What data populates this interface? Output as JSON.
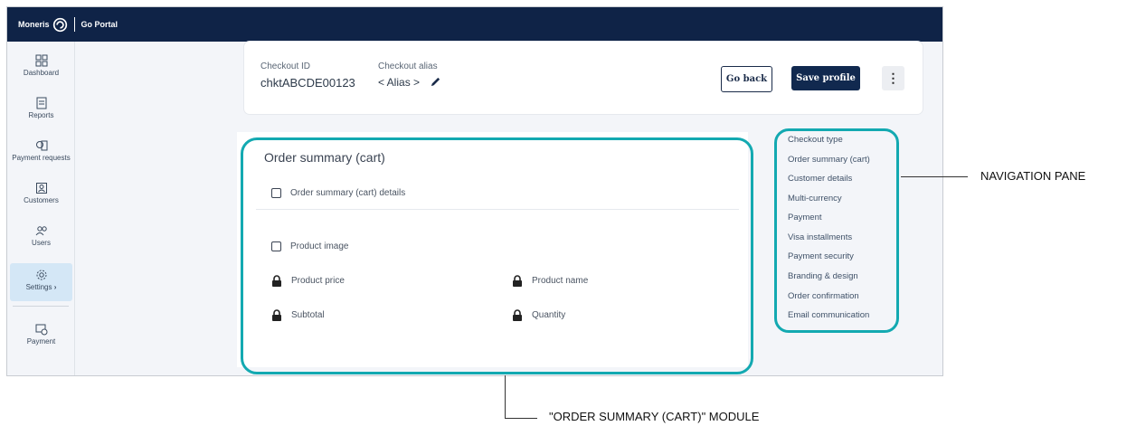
{
  "topbar": {
    "brand": "Moneris",
    "portal_bold": "Go",
    "portal_rest": " Portal"
  },
  "sidebar": {
    "items": [
      {
        "label": "Dashboard",
        "icon": "dashboard-icon"
      },
      {
        "label": "Reports",
        "icon": "reports-icon"
      },
      {
        "label": "Payment requests",
        "icon": "payment-requests-icon"
      },
      {
        "label": "Customers",
        "icon": "customers-icon"
      },
      {
        "label": "Users",
        "icon": "users-icon"
      },
      {
        "label": "Settings",
        "icon": "gear-icon",
        "active": true,
        "chevron": "›"
      },
      {
        "label": "Payment",
        "icon": "payment-icon"
      }
    ]
  },
  "header": {
    "checkout_id_label": "Checkout ID",
    "checkout_id_value": "chktABCDE00123",
    "checkout_alias_label": "Checkout alias",
    "checkout_alias_value": "< Alias >",
    "go_back_label": "Go back",
    "save_label": "Save profile",
    "more_label": "⋮"
  },
  "module": {
    "title": "Order summary (cart)",
    "details_checkbox": "Order summary (cart) details",
    "product_image": "Product image",
    "product_price": "Product price",
    "product_name": "Product name",
    "subtotal": "Subtotal",
    "quantity": "Quantity"
  },
  "right_nav": {
    "items": [
      "Checkout type",
      "Order summary (cart)",
      "Customer details",
      "Multi-currency",
      "Payment",
      "Visa installments",
      "Payment security",
      "Branding & design",
      "Order confirmation",
      "Email communication"
    ]
  },
  "callouts": {
    "navigation_pane": "NAVIGATION PANE",
    "order_summary_module": "\"ORDER SUMMARY (CART)\" MODULE"
  },
  "colors": {
    "topbar": "#0f2347",
    "highlight_outline": "#13a9b1",
    "active_nav": "#d4e7f6"
  }
}
